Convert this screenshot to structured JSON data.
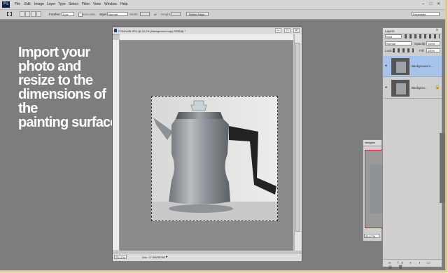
{
  "menubar": {
    "logo": "Ps",
    "items": [
      "File",
      "Edit",
      "Image",
      "Layer",
      "Type",
      "Select",
      "Filter",
      "View",
      "Window",
      "Help"
    ],
    "window_buttons": [
      "–",
      "□",
      "✕"
    ]
  },
  "options": {
    "feather_label": "Feather:",
    "feather_value": "0 px",
    "antialias_label": "Anti-alias",
    "style_label": "Style:",
    "style_value": "Normal",
    "width_label": "Width:",
    "height_label": "Height:",
    "refine_label": "Refine Edge...",
    "workspace_value": "Essentials"
  },
  "instruction": {
    "line1": "Import your",
    "line2": "photo and",
    "line3": "resize to the",
    "line4": "dimensions of the",
    "line5": "painting surface."
  },
  "document": {
    "title": "P7040046.JPG @ 20.2% (Background copy, RGB/8) *",
    "zoom": "20.17%",
    "doc_info": "Doc: 17.0M/36.0M"
  },
  "layers_panel": {
    "title": "Layers",
    "kind_label": "Kind",
    "blend_mode": "Normal",
    "opacity_label": "Opacity:",
    "opacity_value": "100%",
    "lock_label": "Lock:",
    "fill_label": "Fill:",
    "fill_value": "100%",
    "layers": [
      {
        "name": "Background c...",
        "selected": true
      },
      {
        "name": "Backgrou...",
        "selected": false
      }
    ]
  },
  "navigator": {
    "title": "Navigator",
    "zoom": "20.17%"
  },
  "colors": {
    "workspace": "#7d7d7d",
    "selected_layer": "#a9c4ec",
    "nav_box": "#e02020"
  }
}
